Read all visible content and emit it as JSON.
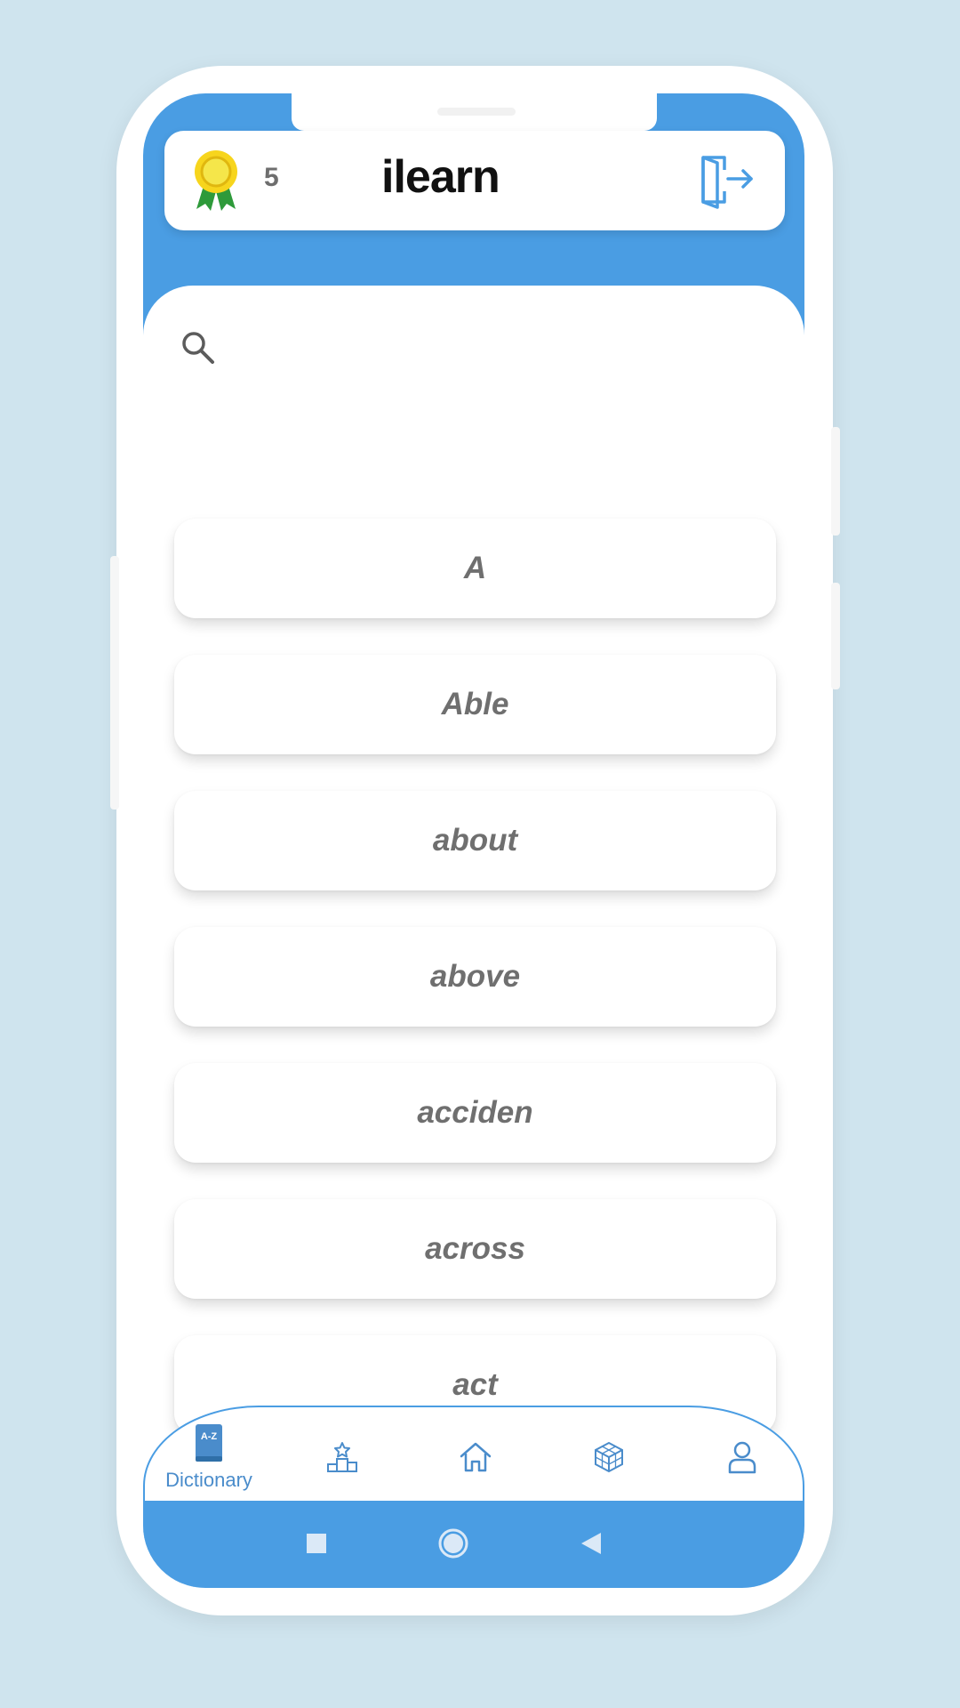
{
  "header": {
    "coin_count": "5",
    "app_title": "ilearn",
    "medal_icon": "medal-icon",
    "logout_icon": "logout-icon"
  },
  "search": {
    "icon": "search-icon",
    "placeholder": ""
  },
  "words": [
    "A",
    "Able",
    "about",
    "above",
    "acciden",
    "across",
    "act",
    ""
  ],
  "bottom_nav": {
    "items": [
      {
        "icon": "dictionary-icon",
        "label": "Dictionary",
        "active": true
      },
      {
        "icon": "leaderboard-icon",
        "label": "",
        "active": false
      },
      {
        "icon": "home-icon",
        "label": "",
        "active": false
      },
      {
        "icon": "cube-icon",
        "label": "",
        "active": false
      },
      {
        "icon": "profile-icon",
        "label": "",
        "active": false
      }
    ]
  },
  "system_nav": [
    "recent-apps-icon",
    "home-circle-icon",
    "back-icon"
  ],
  "colors": {
    "brand_blue": "#4a9de3",
    "background": "#cfe4ee",
    "word_text": "#6f6f6f",
    "medal_gold": "#f7d51d",
    "ribbon_green": "#2e9a3a"
  }
}
